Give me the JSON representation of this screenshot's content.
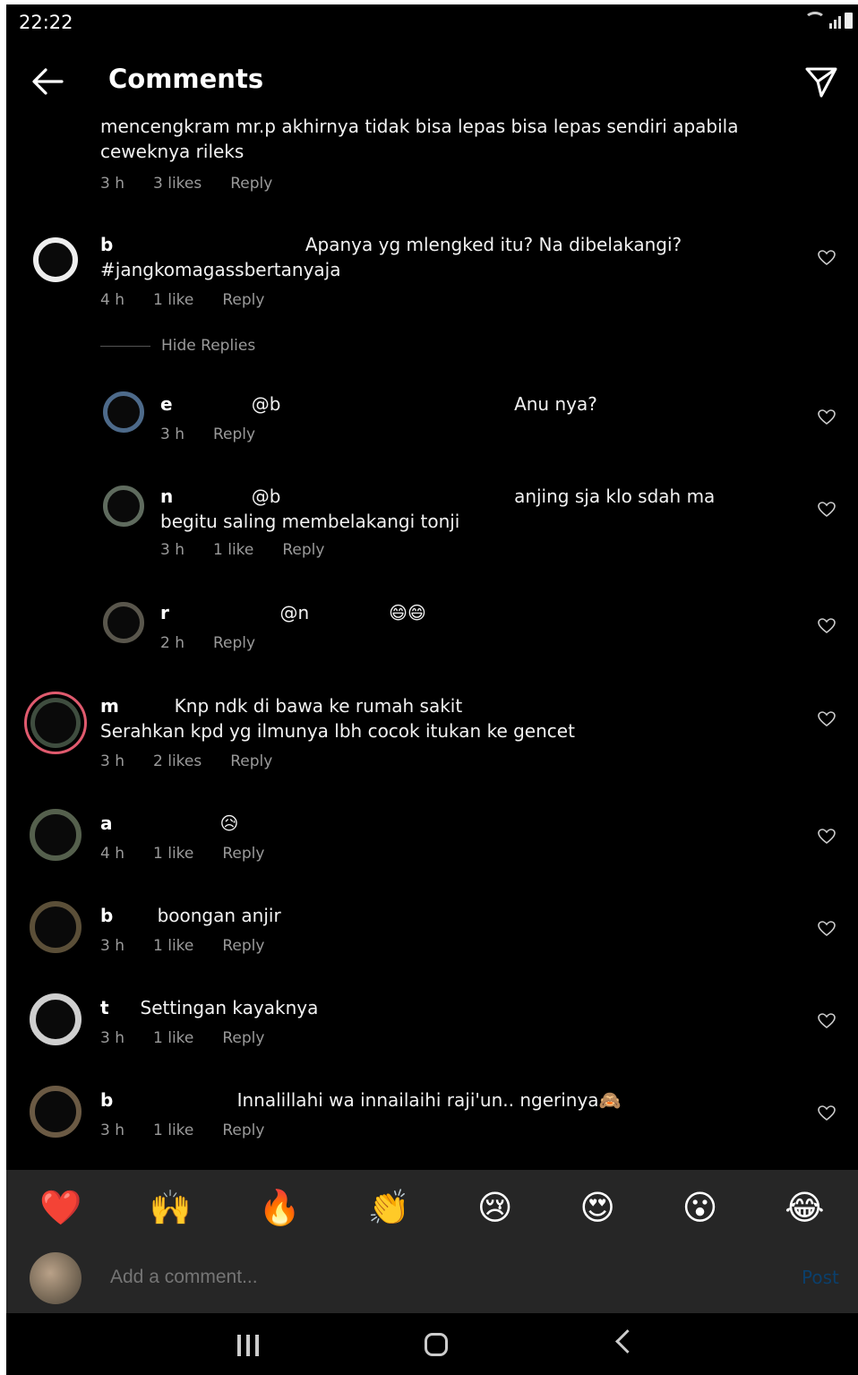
{
  "status_bar": {
    "time": "22:22"
  },
  "header": {
    "title": "Comments"
  },
  "top_comment": {
    "body": "mencengkram mr.p akhirnya tidak bisa lepas bisa lepas sendiri apabila\nceweknya rileks",
    "time": "3 h",
    "likes": "3 likes",
    "reply_label": "Reply"
  },
  "comments": [
    {
      "name": "b",
      "body": "                                    Apanya yg mlengked itu? Na dibelakangi?\n#jangkomagassbertanyaja",
      "time": "4 h",
      "likes": "1 like",
      "reply_label": "Reply"
    },
    {
      "name": "e",
      "body": "                @b                                         Anu nya?",
      "time": "3 h",
      "likes": "",
      "reply_label": "Reply"
    },
    {
      "name": "n",
      "body": "                @b                                         anjing sja klo sdah ma\nbegitu saling membelakangi tonji",
      "time": "3 h",
      "likes": "1 like",
      "reply_label": "Reply"
    },
    {
      "name": "r",
      "body": "                     @n              😄😄",
      "time": "2 h",
      "likes": "",
      "reply_label": "Reply"
    },
    {
      "name": "m",
      "body": "             Knp ndk di bawa ke rumah sakit\nSerahkan kpd yg ilmunya lbh cocok itukan ke gencet",
      "time": "3 h",
      "likes": "2 likes",
      "reply_label": "Reply"
    },
    {
      "name": "a",
      "body": "                     😥",
      "time": "4 h",
      "likes": "1 like",
      "reply_label": "Reply"
    },
    {
      "name": "b",
      "body": "          boongan anjir",
      "time": "3 h",
      "likes": "1 like",
      "reply_label": "Reply"
    },
    {
      "name": "t",
      "body": "       Settingan kayaknya",
      "time": "3 h",
      "likes": "1 like",
      "reply_label": "Reply"
    },
    {
      "name": "b",
      "body": "                        Innalillahi wa innailaihi raji'un.. ngerinya🙈",
      "time": "3 h",
      "likes": "1 like",
      "reply_label": "Reply"
    }
  ],
  "hide_replies_label": "Hide Replies",
  "reaction_bar": [
    "❤️",
    "🙌",
    "🔥",
    "👏",
    "😢",
    "😍",
    "😮",
    "😂"
  ],
  "add_comment": {
    "placeholder": "Add a comment...",
    "post_label": "Post"
  }
}
